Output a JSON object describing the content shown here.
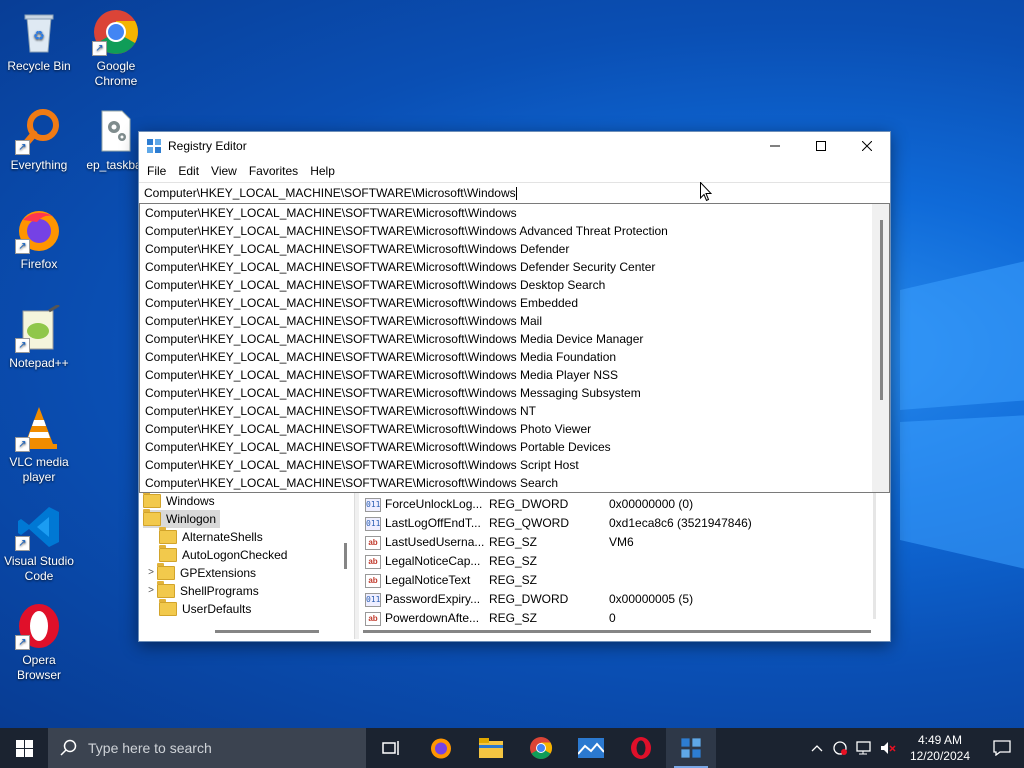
{
  "desktop": {
    "icons": [
      {
        "label": "Recycle Bin",
        "icon": "recycle-bin-icon"
      },
      {
        "label": "Google Chrome",
        "icon": "chrome-icon"
      },
      {
        "label": "Everything",
        "icon": "everything-icon"
      },
      {
        "label": "ep_taskbar",
        "icon": "settings-file-icon"
      },
      {
        "label": "Firefox",
        "icon": "firefox-icon"
      },
      {
        "label": "Notepad++",
        "icon": "notepadpp-icon"
      },
      {
        "label": "VLC media player",
        "icon": "vlc-icon"
      },
      {
        "label": "Visual Studio Code",
        "icon": "vscode-icon"
      },
      {
        "label": "Opera Browser",
        "icon": "opera-icon"
      }
    ]
  },
  "window": {
    "title": "Registry Editor",
    "menu": [
      "File",
      "Edit",
      "View",
      "Favorites",
      "Help"
    ],
    "address": "Computer\\HKEY_LOCAL_MACHINE\\SOFTWARE\\Microsoft\\Windows",
    "suggestions": [
      "Computer\\HKEY_LOCAL_MACHINE\\SOFTWARE\\Microsoft\\Windows",
      "Computer\\HKEY_LOCAL_MACHINE\\SOFTWARE\\Microsoft\\Windows Advanced Threat Protection",
      "Computer\\HKEY_LOCAL_MACHINE\\SOFTWARE\\Microsoft\\Windows Defender",
      "Computer\\HKEY_LOCAL_MACHINE\\SOFTWARE\\Microsoft\\Windows Defender Security Center",
      "Computer\\HKEY_LOCAL_MACHINE\\SOFTWARE\\Microsoft\\Windows Desktop Search",
      "Computer\\HKEY_LOCAL_MACHINE\\SOFTWARE\\Microsoft\\Windows Embedded",
      "Computer\\HKEY_LOCAL_MACHINE\\SOFTWARE\\Microsoft\\Windows Mail",
      "Computer\\HKEY_LOCAL_MACHINE\\SOFTWARE\\Microsoft\\Windows Media Device Manager",
      "Computer\\HKEY_LOCAL_MACHINE\\SOFTWARE\\Microsoft\\Windows Media Foundation",
      "Computer\\HKEY_LOCAL_MACHINE\\SOFTWARE\\Microsoft\\Windows Media Player NSS",
      "Computer\\HKEY_LOCAL_MACHINE\\SOFTWARE\\Microsoft\\Windows Messaging Subsystem",
      "Computer\\HKEY_LOCAL_MACHINE\\SOFTWARE\\Microsoft\\Windows NT",
      "Computer\\HKEY_LOCAL_MACHINE\\SOFTWARE\\Microsoft\\Windows Photo Viewer",
      "Computer\\HKEY_LOCAL_MACHINE\\SOFTWARE\\Microsoft\\Windows Portable Devices",
      "Computer\\HKEY_LOCAL_MACHINE\\SOFTWARE\\Microsoft\\Windows Script Host",
      "Computer\\HKEY_LOCAL_MACHINE\\SOFTWARE\\Microsoft\\Windows Search"
    ],
    "tree": [
      {
        "label": "Windows",
        "expandable": false
      },
      {
        "label": "Winlogon",
        "expandable": false,
        "selected": true
      },
      {
        "label": "AlternateShells",
        "expandable": false
      },
      {
        "label": "AutoLogonChecked",
        "expandable": false
      },
      {
        "label": "GPExtensions",
        "expandable": true
      },
      {
        "label": "ShellPrograms",
        "expandable": true
      },
      {
        "label": "UserDefaults",
        "expandable": false
      }
    ],
    "values": [
      {
        "name": "ForceUnlockLog...",
        "type": "REG_DWORD",
        "data": "0x00000000 (0)",
        "kind": "bin"
      },
      {
        "name": "LastLogOffEndT...",
        "type": "REG_QWORD",
        "data": "0xd1eca8c6 (3521947846)",
        "kind": "bin"
      },
      {
        "name": "LastUsedUserna...",
        "type": "REG_SZ",
        "data": "VM6",
        "kind": "sz"
      },
      {
        "name": "LegalNoticeCap...",
        "type": "REG_SZ",
        "data": "",
        "kind": "sz"
      },
      {
        "name": "LegalNoticeText",
        "type": "REG_SZ",
        "data": "",
        "kind": "sz"
      },
      {
        "name": "PasswordExpiry...",
        "type": "REG_DWORD",
        "data": "0x00000005 (5)",
        "kind": "bin"
      },
      {
        "name": "PowerdownAfte...",
        "type": "REG_SZ",
        "data": "0",
        "kind": "sz"
      }
    ]
  },
  "taskbar": {
    "search_placeholder": "Type here to search",
    "time": "4:49 AM",
    "date": "12/20/2024"
  }
}
